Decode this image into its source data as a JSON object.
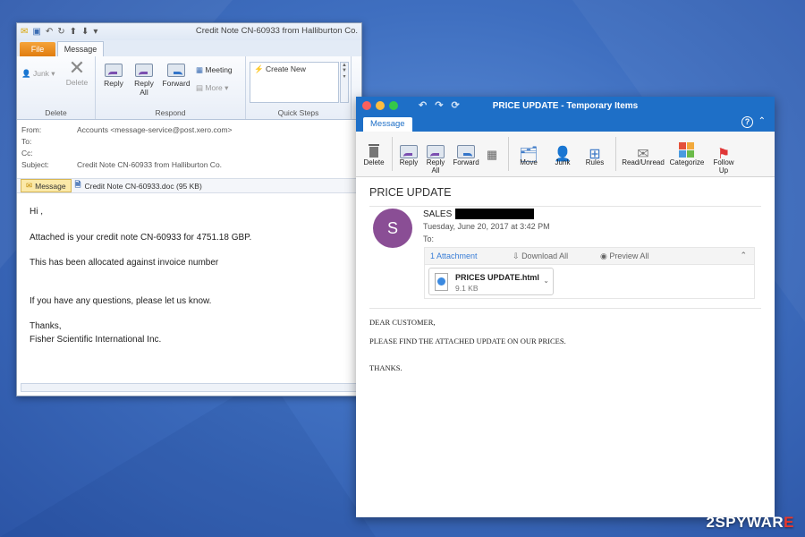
{
  "win": {
    "title": "Credit Note CN-60933 from Halliburton Co.",
    "tabs": {
      "file": "File",
      "message": "Message"
    },
    "ribbon": {
      "junk": "Junk",
      "delete": "Delete",
      "reply": "Reply",
      "reply_all": "Reply All",
      "forward": "Forward",
      "meeting": "Meeting",
      "more": "More",
      "create_new": "Create New",
      "group_delete": "Delete",
      "group_respond": "Respond",
      "group_quick_steps": "Quick Steps"
    },
    "headers": {
      "from_label": "From:",
      "from_value": "Accounts <message-service@post.xero.com>",
      "to_label": "To:",
      "cc_label": "Cc:",
      "subject_label": "Subject:",
      "subject_value": "Credit Note CN-60933 from Halliburton Co."
    },
    "attachments": {
      "message_tab": "Message",
      "file": "Credit Note CN-60933.doc (95 KB)"
    },
    "body": {
      "greeting": "Hi ,",
      "line1": "Attached is your credit note CN-60933 for 4751.18 GBP.",
      "line2": "This has been allocated against invoice number",
      "line3": "If you have any questions, please let us know.",
      "thanks": "Thanks,",
      "signature": "Fisher Scientific International Inc."
    }
  },
  "mac": {
    "title": "PRICE UPDATE - Temporary Items",
    "tab": "Message",
    "ribbon": {
      "delete": "Delete",
      "reply": "Reply",
      "reply_all": "Reply All",
      "forward": "Forward",
      "move": "Move",
      "junk": "Junk",
      "rules": "Rules",
      "read_unread": "Read/Unread",
      "categorize": "Categorize",
      "follow_up": "Follow Up"
    },
    "subject": "PRICE UPDATE",
    "avatar_letter": "S",
    "sender": "SALES",
    "date": "Tuesday, June 20, 2017 at 3:42 PM",
    "to_label": "To:",
    "attachment_bar": {
      "count": "1 Attachment",
      "download_all": "Download All",
      "preview_all": "Preview All"
    },
    "attachment": {
      "name": "PRICES UPDATE.html",
      "size": "9.1 KB"
    },
    "body": {
      "line1": "DEAR CUSTOMER,",
      "line2": "PLEASE FIND THE ATTACHED UPDATE ON OUR PRICES.",
      "line3": "THANKS."
    }
  },
  "watermark": {
    "prefix": "2SPYWAR",
    "suffix": "E"
  },
  "colors": {
    "mac_titlebar": "#1e6fc7",
    "avatar": "#8a4e95",
    "file_tab": "#e07d10",
    "background": "#3f6fc0"
  }
}
